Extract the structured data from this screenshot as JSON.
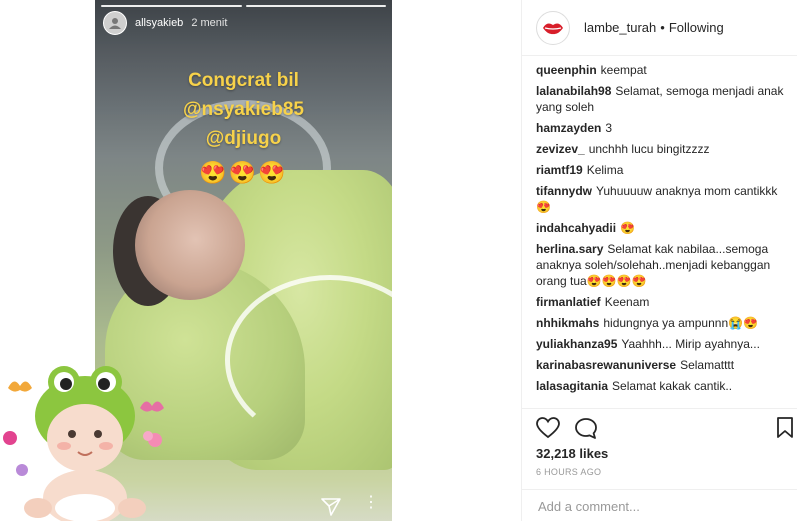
{
  "story": {
    "username": "allsyakieb",
    "time": "2 menit",
    "caption_lines": [
      "Congcrat bil",
      "@nsyakieb85",
      "@djiugo"
    ],
    "emojis": "😍😍😍"
  },
  "post": {
    "username": "lambe_turah",
    "separator": "•",
    "follow_status": "Following",
    "likes": "32,218 likes",
    "time_ago": "6 HOURS AGO",
    "comment_placeholder": "Add a comment..."
  },
  "comments": [
    {
      "user": "queenphin",
      "text": "keempat"
    },
    {
      "user": "lalanabilah98",
      "text": "Selamat, semoga menjadi anak yang soleh"
    },
    {
      "user": "hamzayden",
      "text": "3"
    },
    {
      "user": "zevizev_",
      "text": "unchhh lucu bingitzzzz"
    },
    {
      "user": "riamtf19",
      "text": "Kelima"
    },
    {
      "user": "tifannydw",
      "text": "Yuhuuuuw anaknya mom cantikkk😍"
    },
    {
      "user": "indahcahyadii",
      "text": "😍"
    },
    {
      "user": "herlina.sary",
      "text": "Selamat kak nabilaa...semoga anaknya soleh/solehah..menjadi kebanggan orang tua😍😍😍😍"
    },
    {
      "user": "firmanlatief",
      "text": "Keenam"
    },
    {
      "user": "nhhikmahs",
      "text": "hidungnya ya ampunnn😭😍"
    },
    {
      "user": "yuliakhanza95",
      "text": "Yaahhh... Mirip ayahnya..."
    },
    {
      "user": "karinabasrewanuniverse",
      "text": "Selamatttt"
    },
    {
      "user": "lalasagitania",
      "text": "Selamat kakak cantik.."
    }
  ],
  "icons": {
    "heart": "heart-icon",
    "comment": "comment-icon",
    "bookmark": "bookmark-icon",
    "send": "send-icon",
    "avatar": "lips-avatar"
  },
  "colors": {
    "caption": "#f7d24a",
    "text": "#262626",
    "muted": "#999999",
    "lips": "#d81e2a"
  }
}
